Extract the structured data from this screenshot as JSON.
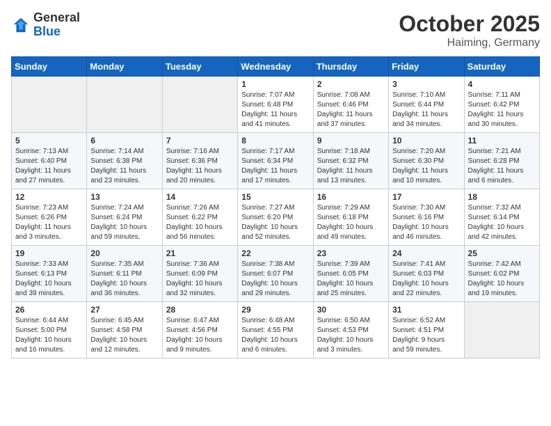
{
  "header": {
    "logo_general": "General",
    "logo_blue": "Blue",
    "month": "October 2025",
    "location": "Haiming, Germany"
  },
  "weekdays": [
    "Sunday",
    "Monday",
    "Tuesday",
    "Wednesday",
    "Thursday",
    "Friday",
    "Saturday"
  ],
  "weeks": [
    [
      {
        "day": "",
        "info": ""
      },
      {
        "day": "",
        "info": ""
      },
      {
        "day": "",
        "info": ""
      },
      {
        "day": "1",
        "info": "Sunrise: 7:07 AM\nSunset: 6:48 PM\nDaylight: 11 hours\nand 41 minutes."
      },
      {
        "day": "2",
        "info": "Sunrise: 7:08 AM\nSunset: 6:46 PM\nDaylight: 11 hours\nand 37 minutes."
      },
      {
        "day": "3",
        "info": "Sunrise: 7:10 AM\nSunset: 6:44 PM\nDaylight: 11 hours\nand 34 minutes."
      },
      {
        "day": "4",
        "info": "Sunrise: 7:11 AM\nSunset: 6:42 PM\nDaylight: 11 hours\nand 30 minutes."
      }
    ],
    [
      {
        "day": "5",
        "info": "Sunrise: 7:13 AM\nSunset: 6:40 PM\nDaylight: 11 hours\nand 27 minutes."
      },
      {
        "day": "6",
        "info": "Sunrise: 7:14 AM\nSunset: 6:38 PM\nDaylight: 11 hours\nand 23 minutes."
      },
      {
        "day": "7",
        "info": "Sunrise: 7:16 AM\nSunset: 6:36 PM\nDaylight: 11 hours\nand 20 minutes."
      },
      {
        "day": "8",
        "info": "Sunrise: 7:17 AM\nSunset: 6:34 PM\nDaylight: 11 hours\nand 17 minutes."
      },
      {
        "day": "9",
        "info": "Sunrise: 7:18 AM\nSunset: 6:32 PM\nDaylight: 11 hours\nand 13 minutes."
      },
      {
        "day": "10",
        "info": "Sunrise: 7:20 AM\nSunset: 6:30 PM\nDaylight: 11 hours\nand 10 minutes."
      },
      {
        "day": "11",
        "info": "Sunrise: 7:21 AM\nSunset: 6:28 PM\nDaylight: 11 hours\nand 6 minutes."
      }
    ],
    [
      {
        "day": "12",
        "info": "Sunrise: 7:23 AM\nSunset: 6:26 PM\nDaylight: 11 hours\nand 3 minutes."
      },
      {
        "day": "13",
        "info": "Sunrise: 7:24 AM\nSunset: 6:24 PM\nDaylight: 10 hours\nand 59 minutes."
      },
      {
        "day": "14",
        "info": "Sunrise: 7:26 AM\nSunset: 6:22 PM\nDaylight: 10 hours\nand 56 minutes."
      },
      {
        "day": "15",
        "info": "Sunrise: 7:27 AM\nSunset: 6:20 PM\nDaylight: 10 hours\nand 52 minutes."
      },
      {
        "day": "16",
        "info": "Sunrise: 7:29 AM\nSunset: 6:18 PM\nDaylight: 10 hours\nand 49 minutes."
      },
      {
        "day": "17",
        "info": "Sunrise: 7:30 AM\nSunset: 6:16 PM\nDaylight: 10 hours\nand 46 minutes."
      },
      {
        "day": "18",
        "info": "Sunrise: 7:32 AM\nSunset: 6:14 PM\nDaylight: 10 hours\nand 42 minutes."
      }
    ],
    [
      {
        "day": "19",
        "info": "Sunrise: 7:33 AM\nSunset: 6:13 PM\nDaylight: 10 hours\nand 39 minutes."
      },
      {
        "day": "20",
        "info": "Sunrise: 7:35 AM\nSunset: 6:11 PM\nDaylight: 10 hours\nand 36 minutes."
      },
      {
        "day": "21",
        "info": "Sunrise: 7:36 AM\nSunset: 6:09 PM\nDaylight: 10 hours\nand 32 minutes."
      },
      {
        "day": "22",
        "info": "Sunrise: 7:38 AM\nSunset: 6:07 PM\nDaylight: 10 hours\nand 29 minutes."
      },
      {
        "day": "23",
        "info": "Sunrise: 7:39 AM\nSunset: 6:05 PM\nDaylight: 10 hours\nand 25 minutes."
      },
      {
        "day": "24",
        "info": "Sunrise: 7:41 AM\nSunset: 6:03 PM\nDaylight: 10 hours\nand 22 minutes."
      },
      {
        "day": "25",
        "info": "Sunrise: 7:42 AM\nSunset: 6:02 PM\nDaylight: 10 hours\nand 19 minutes."
      }
    ],
    [
      {
        "day": "26",
        "info": "Sunrise: 6:44 AM\nSunset: 5:00 PM\nDaylight: 10 hours\nand 16 minutes."
      },
      {
        "day": "27",
        "info": "Sunrise: 6:45 AM\nSunset: 4:58 PM\nDaylight: 10 hours\nand 12 minutes."
      },
      {
        "day": "28",
        "info": "Sunrise: 6:47 AM\nSunset: 4:56 PM\nDaylight: 10 hours\nand 9 minutes."
      },
      {
        "day": "29",
        "info": "Sunrise: 6:48 AM\nSunset: 4:55 PM\nDaylight: 10 hours\nand 6 minutes."
      },
      {
        "day": "30",
        "info": "Sunrise: 6:50 AM\nSunset: 4:53 PM\nDaylight: 10 hours\nand 3 minutes."
      },
      {
        "day": "31",
        "info": "Sunrise: 6:52 AM\nSunset: 4:51 PM\nDaylight: 9 hours\nand 59 minutes."
      },
      {
        "day": "",
        "info": ""
      }
    ]
  ]
}
